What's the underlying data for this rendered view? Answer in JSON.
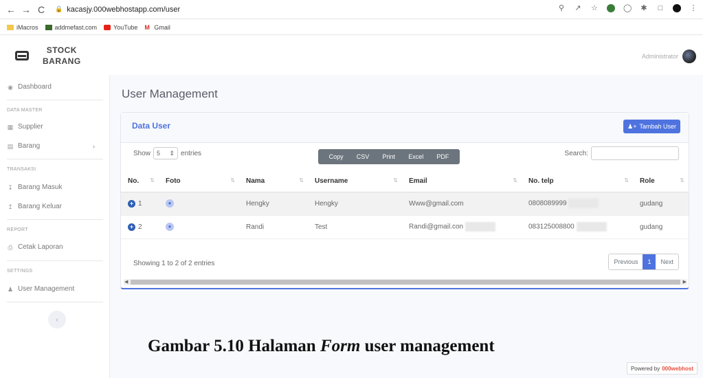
{
  "browser": {
    "back": "←",
    "forward": "→",
    "reload": "C",
    "url": "kacasjy.000webhostapp.com/user",
    "bookmarks": [
      "iMacros",
      "addmefast.com",
      "YouTube",
      "Gmail"
    ]
  },
  "header": {
    "brand_line1": "STOCK",
    "brand_line2": "BARANG",
    "user_name": "Administrator"
  },
  "sidebar": {
    "dashboard": "Dashboard",
    "head_master": "DATA MASTER",
    "supplier": "Supplier",
    "barang": "Barang",
    "head_transaksi": "TRANSAKSI",
    "barang_masuk": "Barang Masuk",
    "barang_keluar": "Barang Keluar",
    "head_report": "REPORT",
    "cetak_laporan": "Cetak Laporan",
    "head_settings": "SETTINGS",
    "user_management": "User Management"
  },
  "main": {
    "page_title": "User Management",
    "card_title": "Data User",
    "add_button": "Tambah User",
    "show": "Show",
    "entries_value": "5",
    "entries": "entries",
    "export": [
      "Copy",
      "CSV",
      "Print",
      "Excel",
      "PDF"
    ],
    "search_label": "Search:",
    "columns": [
      "No.",
      "Foto",
      "Nama",
      "Username",
      "Email",
      "No. telp",
      "Role"
    ],
    "rows": [
      {
        "no": "1",
        "nama": "Hengky",
        "username": "Hengky",
        "email": "Www@gmail.com",
        "telp": "0808089999",
        "role": "gudang"
      },
      {
        "no": "2",
        "nama": "Randi",
        "username": "Test",
        "email": "Randi@gmail.con",
        "telp": "083125008800",
        "role": "gudang"
      }
    ],
    "info": "Showing 1 to 2 of 2 entries",
    "pager": {
      "previous": "Previous",
      "page": "1",
      "next": "Next"
    }
  },
  "caption": {
    "before": "Gambar 5.10 Halaman ",
    "italic": "Form",
    "after": " user management"
  },
  "powered": {
    "text": "Powered by",
    "brand": "000webhost"
  }
}
